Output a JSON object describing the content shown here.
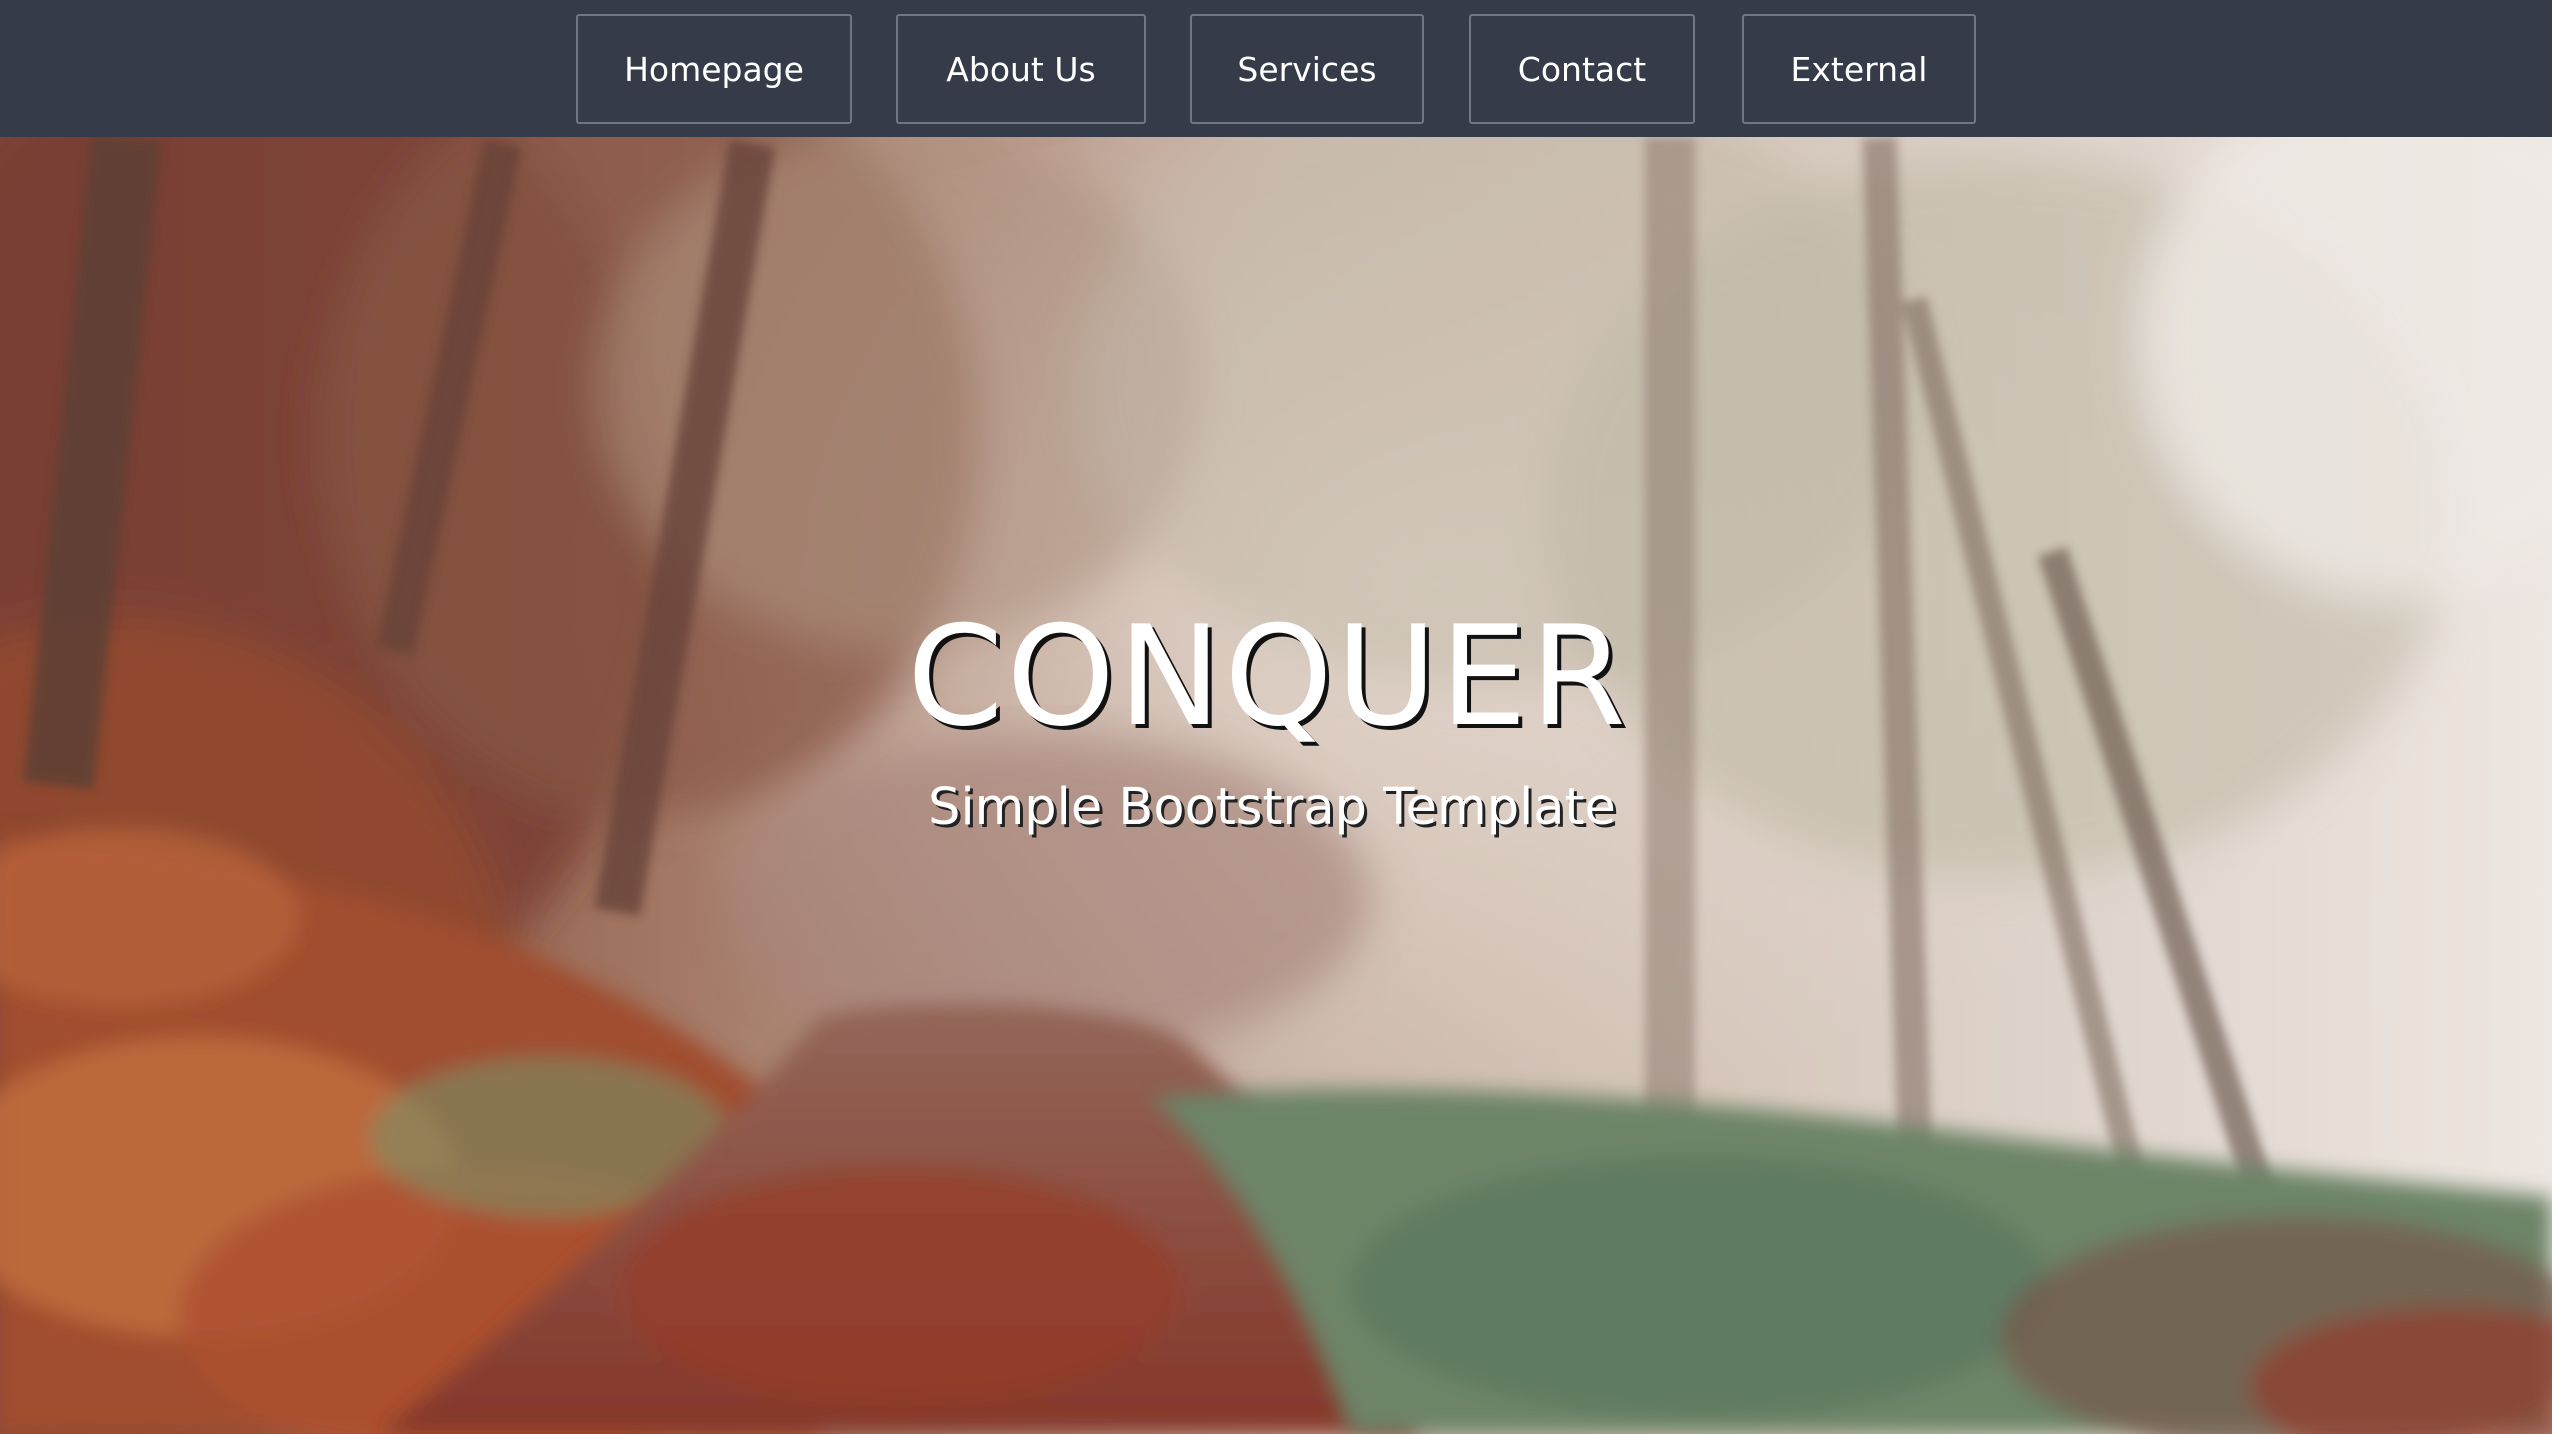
{
  "nav": {
    "items": [
      {
        "label": "Homepage"
      },
      {
        "label": "About Us"
      },
      {
        "label": "Services"
      },
      {
        "label": "Contact"
      },
      {
        "label": "External"
      }
    ]
  },
  "hero": {
    "title": "CONQUER",
    "subtitle": "Simple Bootstrap Template"
  },
  "colors": {
    "navbar_bg": "#353b48",
    "nav_border": "#707784",
    "text": "#ffffff"
  }
}
